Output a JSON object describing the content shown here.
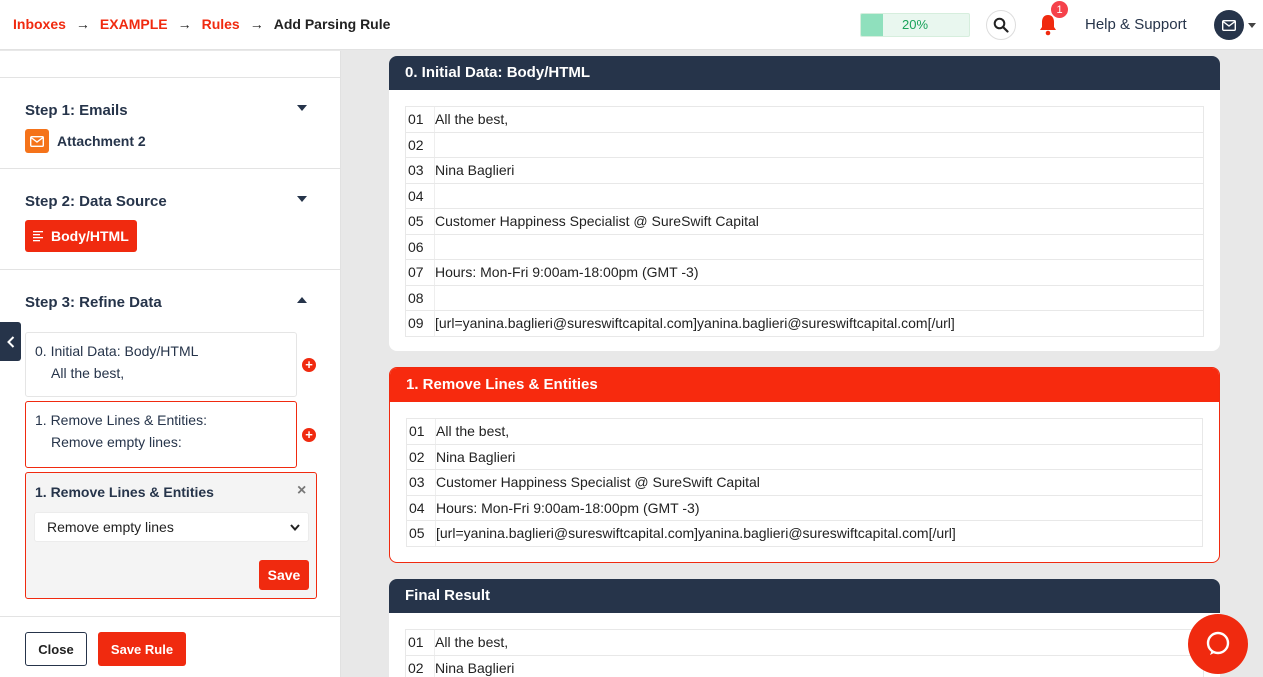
{
  "breadcrumb": {
    "items": [
      "Inboxes",
      "EXAMPLE",
      "Rules"
    ],
    "separator": "→",
    "current": "Add Parsing Rule"
  },
  "header": {
    "progress_percent": 20,
    "progress_label": "20%",
    "notification_count": "1",
    "help_label": "Help & Support",
    "search_icon": "search-icon",
    "bell_icon": "bell-icon",
    "account_icon": "envelope-icon"
  },
  "sidebar": {
    "step1": {
      "title": "Step 1: Emails",
      "attachment_label": "Attachment 2"
    },
    "step2": {
      "title": "Step 2: Data Source",
      "source_label": "Body/HTML"
    },
    "step3": {
      "title": "Step 3: Refine Data",
      "cards": [
        {
          "title": "0. Initial Data: Body/HTML",
          "subtitle": "All the best,"
        },
        {
          "title": "1. Remove Lines & Entities:",
          "subtitle": "Remove empty lines:"
        }
      ],
      "editor": {
        "title": "1. Remove Lines & Entities",
        "close_symbol": "×",
        "selected_option": "Remove empty lines",
        "save_label": "Save"
      }
    },
    "close_label": "Close",
    "save_rule_label": "Save Rule"
  },
  "panels": [
    {
      "title": "0. Initial Data: Body/HTML",
      "rows": [
        {
          "num": "01",
          "text": "All the best,"
        },
        {
          "num": "02",
          "text": ""
        },
        {
          "num": "03",
          "text": "Nina Baglieri"
        },
        {
          "num": "04",
          "text": ""
        },
        {
          "num": "05",
          "text": "Customer Happiness Specialist @ SureSwift Capital"
        },
        {
          "num": "06",
          "text": ""
        },
        {
          "num": "07",
          "text": "Hours: Mon-Fri 9:00am-18:00pm (GMT -3)"
        },
        {
          "num": "08",
          "text": ""
        },
        {
          "num": "09",
          "text": "[url=yanina.baglieri@sureswiftcapital.com]yanina.baglieri@sureswiftcapital.com[/url]"
        }
      ]
    },
    {
      "title": "1. Remove Lines & Entities",
      "rows": [
        {
          "num": "01",
          "text": "All the best,"
        },
        {
          "num": "02",
          "text": "Nina Baglieri"
        },
        {
          "num": "03",
          "text": "Customer Happiness Specialist @ SureSwift Capital"
        },
        {
          "num": "04",
          "text": "Hours: Mon-Fri 9:00am-18:00pm (GMT -3)"
        },
        {
          "num": "05",
          "text": "[url=yanina.baglieri@sureswiftcapital.com]yanina.baglieri@sureswiftcapital.com[/url]"
        }
      ]
    },
    {
      "title": "Final Result",
      "rows": [
        {
          "num": "01",
          "text": "All the best,"
        },
        {
          "num": "02",
          "text": "Nina Baglieri"
        }
      ]
    }
  ],
  "colors": {
    "brand_red": "#f02a0f",
    "navy": "#26344a",
    "attachment_orange": "#f5731a",
    "progress_green": "#8fe0bd"
  }
}
